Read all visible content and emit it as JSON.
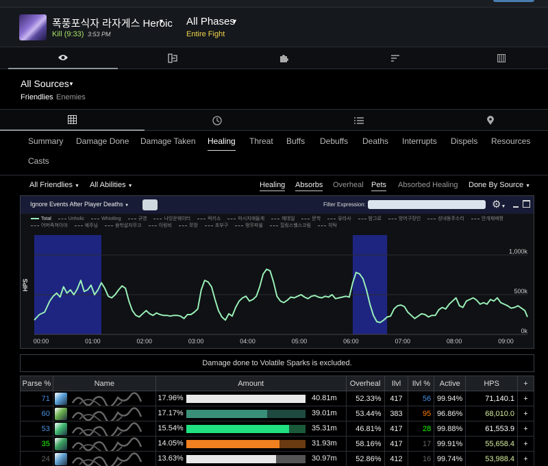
{
  "header": {
    "boss_name": "폭풍포식자 라자게스 Heroic",
    "kill": "Kill (9:33)",
    "time": "3:53 PM",
    "phase": "All Phases",
    "phase_sub": "Entire Fight"
  },
  "view_tabs": [
    {
      "icon": "eye-icon",
      "active": true
    },
    {
      "icon": "swap-icon",
      "active": false
    },
    {
      "icon": "puzzle-icon",
      "active": false
    },
    {
      "icon": "sort-icon",
      "active": false
    },
    {
      "icon": "columns-icon",
      "active": false
    }
  ],
  "sources": {
    "label": "All Sources",
    "friendlies": "Friendlies",
    "enemies": "Enemies"
  },
  "mode_tabs": [
    {
      "icon": "grid-icon",
      "active": true
    },
    {
      "icon": "clock-icon",
      "active": false
    },
    {
      "icon": "list-icon",
      "active": false
    },
    {
      "icon": "map-pin-icon",
      "active": false
    }
  ],
  "report_tabs": [
    "Summary",
    "Damage Done",
    "Damage Taken",
    "Healing",
    "Threat",
    "Buffs",
    "Debuffs",
    "Deaths",
    "Interrupts",
    "Dispels",
    "Resources",
    "Casts"
  ],
  "active_report_tab": "Healing",
  "filters": {
    "friendlies": "All Friendlies",
    "abilities": "All Abilities",
    "healing": "Healing",
    "absorbs": "Absorbs",
    "overheal": "Overheal",
    "pets": "Pets",
    "absorbed": "Absorbed Healing",
    "done_by": "Done By Source"
  },
  "chart_panel": {
    "ignore_label": "Ignore Events After Player Deaths",
    "filter_label": "Filter Expression:"
  },
  "chart_data": {
    "type": "line",
    "ylabel": "HPS",
    "y_ticks": [
      "0k",
      "500k",
      "1,000k"
    ],
    "ylim": [
      0,
      1250000
    ],
    "x_ticks": [
      "00:00",
      "01:00",
      "02:00",
      "03:00",
      "04:00",
      "05:00",
      "06:00",
      "07:00",
      "08:00",
      "09:00"
    ],
    "xlim_seconds": [
      0,
      573
    ],
    "highlight_ranges_seconds": [
      [
        0,
        78
      ],
      [
        370,
        410
      ]
    ],
    "legend": [
      "Total",
      "Unholic",
      "Whistling",
      "규영",
      "나잉운웨이터",
      "럭키소",
      "마시지애들게",
      "헤데일",
      "문학",
      "유라사",
      "밤그로",
      "방어구장인",
      "성내동주수리",
      "안개재배짱",
      "어머죽쳐이야",
      "예주님",
      "용학살자무크",
      "이링비",
      "쪼땅",
      "초부구",
      "펑무파윌",
      "힐링스웰스크림",
      "히탁"
    ],
    "series": [
      {
        "name": "Total",
        "color": "#9af0b8",
        "x": [
          0,
          6,
          12,
          18,
          22,
          26,
          30,
          34,
          38,
          42,
          46,
          50,
          54,
          58,
          62,
          66,
          70,
          74,
          78,
          82,
          86,
          90,
          94,
          98,
          102,
          106,
          110,
          114,
          118,
          122,
          126,
          130,
          134,
          138,
          142,
          146,
          150,
          154,
          158,
          162,
          166,
          170,
          174,
          178,
          182,
          186,
          190,
          194,
          198,
          202,
          206,
          210,
          214,
          218,
          222,
          226,
          230,
          234,
          238,
          242,
          246,
          250,
          254,
          258,
          262,
          266,
          270,
          274,
          278,
          282,
          286,
          290,
          294,
          298,
          302,
          306,
          310,
          314,
          318,
          322,
          326,
          330,
          334,
          338,
          342,
          346,
          350,
          354,
          358,
          362,
          366,
          370,
          374,
          378,
          382,
          386,
          390,
          394,
          398,
          402,
          406,
          410,
          414,
          418,
          422,
          426,
          430,
          434,
          438,
          442,
          446,
          450,
          454,
          458,
          462,
          466,
          470,
          474,
          478,
          482,
          486,
          490,
          494,
          498,
          502,
          506,
          510,
          514,
          518,
          522,
          526,
          530,
          534,
          538,
          542,
          546,
          550,
          554,
          558,
          562,
          566,
          570,
          573
        ],
        "values": [
          180000,
          250000,
          280000,
          420000,
          480000,
          520000,
          470000,
          600000,
          520000,
          560000,
          500000,
          570000,
          680000,
          540000,
          560000,
          620000,
          500000,
          560000,
          650000,
          580000,
          480000,
          460000,
          500000,
          560000,
          610000,
          580000,
          420000,
          300000,
          240000,
          220000,
          260000,
          300000,
          260000,
          240000,
          270000,
          250000,
          240000,
          240000,
          230000,
          240000,
          240000,
          230000,
          200000,
          250000,
          250000,
          280000,
          320000,
          560000,
          680000,
          660000,
          600000,
          440000,
          300000,
          220000,
          180000,
          260000,
          230000,
          340000,
          420000,
          460000,
          480000,
          420000,
          440000,
          480000,
          600000,
          760000,
          820000,
          800000,
          660000,
          480000,
          420000,
          400000,
          430000,
          470000,
          460000,
          480000,
          500000,
          470000,
          450000,
          480000,
          490000,
          470000,
          460000,
          480000,
          470000,
          500000,
          450000,
          460000,
          470000,
          480000,
          470000,
          650000,
          780000,
          760000,
          700000,
          560000,
          380000,
          240000,
          160000,
          150000,
          180000,
          220000,
          230000,
          320000,
          360000,
          370000,
          350000,
          280000,
          240000,
          200000,
          230000,
          260000,
          250000,
          220000,
          240000,
          240000,
          310000,
          340000,
          320000,
          380000,
          420000,
          460000,
          360000,
          340000,
          420000,
          440000,
          460000,
          430000,
          380000,
          400000,
          380000,
          440000,
          420000,
          460000,
          400000,
          380000,
          360000,
          330000,
          340000,
          360000,
          330000,
          300000,
          220000
        ]
      }
    ]
  },
  "notice": "Damage done to Volatile Sparks is excluded.",
  "table": {
    "headers": [
      "Parse %",
      "Name",
      "Amount",
      "Overheal",
      "Ilvl",
      "Ilvl %",
      "Active",
      "HPS",
      "+"
    ],
    "rows": [
      {
        "parse": "71",
        "parse_color": "#4a90e2",
        "icon_color": "#5aa0d8",
        "pct": "17.96%",
        "bar_frac": 1.0,
        "bar_color": "#e8e8e8",
        "bar_bg": "#e8e8e8",
        "amount": "40.81m",
        "overheal": "52.33%",
        "ilvl": "417",
        "ilvl_pct": "56",
        "ilvl_pct_color": "#4a90e2",
        "active": "99.94%",
        "hps": "71,140.1",
        "hps_color": "#ffffff"
      },
      {
        "parse": "60",
        "parse_color": "#4a90e2",
        "icon_color": "#6ab04c",
        "pct": "17.17%",
        "bar_frac": 0.68,
        "bar_color": "#3a8f78",
        "bar_bg": "#1e4a40",
        "amount": "39.01m",
        "overheal": "53.44%",
        "ilvl": "383",
        "ilvl_pct": "95",
        "ilvl_pct_color": "#ff8000",
        "active": "96.86%",
        "hps": "68,010.0",
        "hps_color": "#d8f0a0"
      },
      {
        "parse": "53",
        "parse_color": "#4a90e2",
        "icon_color": "#40b870",
        "pct": "15.54%",
        "bar_frac": 0.86,
        "bar_color": "#20e080",
        "bar_bg": "#1a5a3a",
        "amount": "35.31m",
        "overheal": "46.81%",
        "ilvl": "417",
        "ilvl_pct": "28",
        "ilvl_pct_color": "#1eff00",
        "active": "99.88%",
        "hps": "61,553.9",
        "hps_color": "#ffffff"
      },
      {
        "parse": "35",
        "parse_color": "#1eff00",
        "icon_color": "#3aa060",
        "pct": "14.05%",
        "bar_frac": 0.78,
        "bar_color": "#f08020",
        "bar_bg": "#6a3a10",
        "amount": "31.93m",
        "overheal": "58.16%",
        "ilvl": "417",
        "ilvl_pct": "17",
        "ilvl_pct_color": "#666666",
        "active": "99.91%",
        "hps": "55,658.4",
        "hps_color": "#d8f0a0"
      },
      {
        "parse": "24",
        "parse_color": "#666666",
        "icon_color": "#60a0d0",
        "pct": "13.63%",
        "bar_frac": 0.75,
        "bar_color": "#e8e8e8",
        "bar_bg": "#555555",
        "amount": "30.97m",
        "overheal": "52.86%",
        "ilvl": "412",
        "ilvl_pct": "16",
        "ilvl_pct_color": "#666666",
        "active": "99.74%",
        "hps": "53,988.4",
        "hps_color": "#d8f0a0"
      }
    ]
  }
}
